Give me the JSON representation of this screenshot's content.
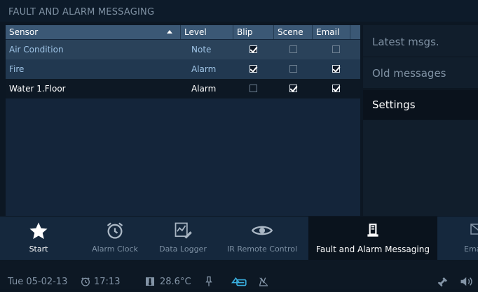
{
  "title": "FAULT AND ALARM MESSAGING",
  "table": {
    "columns": [
      "Sensor",
      "Level",
      "Blip",
      "Scene",
      "Email"
    ],
    "rows": [
      {
        "sensor": "Air Condition",
        "level": "Note",
        "blip": true,
        "scene": false,
        "email": false
      },
      {
        "sensor": "Fire",
        "level": "Alarm",
        "blip": true,
        "scene": false,
        "email": true
      },
      {
        "sensor": "Water 1.Floor",
        "level": "Alarm",
        "blip": false,
        "scene": true,
        "email": true
      }
    ]
  },
  "side_menu": {
    "items": [
      "Latest msgs.",
      "Old messages",
      "Settings"
    ],
    "selected": "Settings"
  },
  "apps": {
    "items": [
      "Start",
      "Alarm Clock",
      "Data Logger",
      "IR Remote Control",
      "Fault and Alarm Messaging",
      "Ema"
    ],
    "selected": "Fault and Alarm Messaging"
  },
  "status": {
    "date": "Tue 05-02-13",
    "time": "17:13",
    "temperature": "28.6°C"
  },
  "colors": {
    "background": "#0c1723",
    "header_row": "#3b5875",
    "row_highlight": "#2a425a",
    "selected": "#0a121c"
  }
}
